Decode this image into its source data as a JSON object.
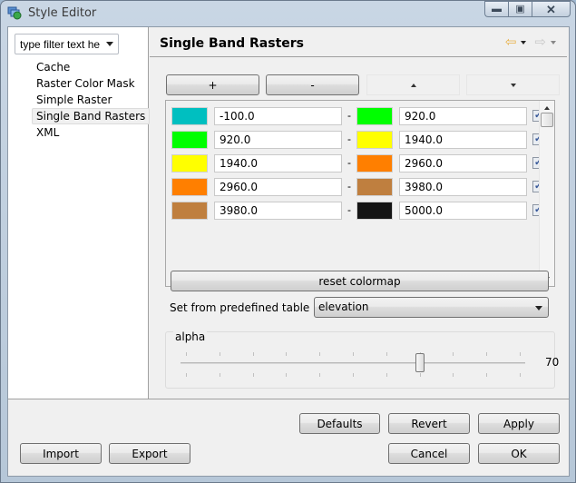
{
  "window": {
    "title": "Style Editor",
    "app_icon": "style-editor-globe-icon",
    "controls": {
      "minimize": "minimize-icon",
      "maximize": "maximize-icon",
      "close": "close-icon"
    }
  },
  "sidebar": {
    "filter": {
      "value": "type filter text he"
    },
    "items": [
      {
        "label": "Cache",
        "selected": false
      },
      {
        "label": "Raster Color Mask",
        "selected": false
      },
      {
        "label": "Simple Raster",
        "selected": false
      },
      {
        "label": "Single Band Rasters",
        "selected": true
      },
      {
        "label": "XML",
        "selected": false
      }
    ]
  },
  "page": {
    "title": "Single Band Rasters",
    "nav": {
      "back_icon": "back-arrow-icon",
      "forward_icon": "forward-arrow-icon"
    }
  },
  "toolbar": {
    "add_label": "+",
    "remove_label": "-",
    "move_up_icon": "arrow-up-icon",
    "move_down_icon": "arrow-down-icon"
  },
  "colormap": {
    "separator": "-",
    "rows": [
      {
        "from_color": "#00bfc0",
        "from": "-100.0",
        "to_color": "#00ff00",
        "to": "920.0",
        "enabled": true
      },
      {
        "from_color": "#00ff00",
        "from": "920.0",
        "to_color": "#ffff00",
        "to": "1940.0",
        "enabled": true
      },
      {
        "from_color": "#ffff00",
        "from": "1940.0",
        "to_color": "#ff7f00",
        "to": "2960.0",
        "enabled": true
      },
      {
        "from_color": "#ff7f00",
        "from": "2960.0",
        "to_color": "#bf7f3f",
        "to": "3980.0",
        "enabled": true
      },
      {
        "from_color": "#bf7f3f",
        "from": "3980.0",
        "to_color": "#141414",
        "to": "5000.0",
        "enabled": true
      }
    ]
  },
  "reset_label": "reset colormap",
  "predefined": {
    "label": "Set from predefined table",
    "value": "elevation"
  },
  "alpha": {
    "label": "alpha",
    "value": "70",
    "fraction": 0.7
  },
  "buttons": {
    "defaults": "Defaults",
    "revert": "Revert",
    "apply": "Apply",
    "import": "Import",
    "export": "Export",
    "cancel": "Cancel",
    "ok": "OK"
  }
}
